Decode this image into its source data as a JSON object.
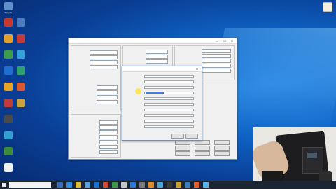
{
  "desktop": {
    "icons_left": [
      {
        "name": "recycle-bin-icon",
        "label": "Recycle",
        "color": "#5d8fc9"
      },
      {
        "name": "app-icon",
        "label": "",
        "color": "#c43b2e"
      },
      {
        "name": "app-icon",
        "label": "",
        "color": "#e0a02a"
      },
      {
        "name": "app-icon",
        "label": "",
        "color": "#3c9d4a"
      },
      {
        "name": "app-icon",
        "label": "",
        "color": "#1e6fd0"
      },
      {
        "name": "app-icon",
        "label": "",
        "color": "#e8a323"
      },
      {
        "name": "app-icon",
        "label": "",
        "color": "#c23a3a"
      },
      {
        "name": "app-icon",
        "label": "",
        "color": "#4a4a4a"
      },
      {
        "name": "app-icon",
        "label": "",
        "color": "#2fa0d0"
      },
      {
        "name": "app-icon",
        "label": "",
        "color": "#3b8b3b"
      },
      {
        "name": "document-icon",
        "label": "",
        "color": "#f2f2f2"
      }
    ],
    "icons_col2": [
      {
        "name": "app-icon",
        "label": "",
        "color": "#4b7bbd"
      },
      {
        "name": "app-icon",
        "label": "",
        "color": "#c23a3a"
      },
      {
        "name": "app-icon",
        "label": "",
        "color": "#36a0d8"
      },
      {
        "name": "app-icon",
        "label": "",
        "color": "#2f9f6d"
      },
      {
        "name": "app-icon",
        "label": "",
        "color": "#d85a2a"
      },
      {
        "name": "app-icon",
        "label": "",
        "color": "#c8a23a"
      }
    ],
    "top_right_icon": {
      "name": "file-icon",
      "label": ""
    }
  },
  "main_window": {
    "title": "",
    "left_panel": {
      "fields": [
        {
          "label": "",
          "value": ""
        },
        {
          "label": "",
          "value": ""
        },
        {
          "label": "",
          "value": ""
        },
        {
          "label": "",
          "value": ""
        }
      ]
    }
  },
  "dialog": {
    "title": "",
    "fields": [
      {
        "label": "",
        "value": ""
      },
      {
        "label": "",
        "value": ""
      },
      {
        "label": "",
        "value": ""
      },
      {
        "label": "",
        "value": ""
      },
      {
        "label": "",
        "value": ""
      },
      {
        "label": "",
        "value": ""
      },
      {
        "label": "",
        "value": ""
      },
      {
        "label": "",
        "value": ""
      },
      {
        "label": "",
        "value": ""
      },
      {
        "label": "",
        "value": ""
      }
    ],
    "buttons": {
      "ok": "",
      "cancel": ""
    }
  },
  "taskbar": {
    "search_placeholder": "",
    "clock": ""
  }
}
